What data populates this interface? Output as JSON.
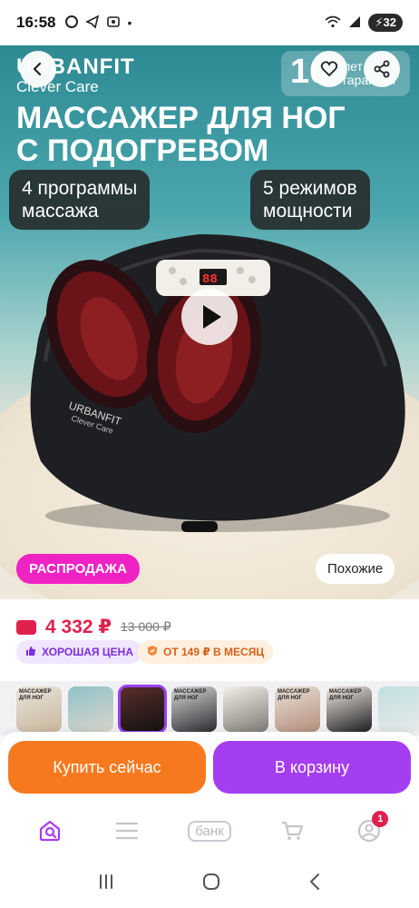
{
  "status_bar": {
    "time": "16:58",
    "battery": "32"
  },
  "hero": {
    "brand_name": "URBANFIT",
    "brand_sub": "Clever Care",
    "warranty_number": "10",
    "warranty_text_1": "лет",
    "warranty_text_2": "гарантии",
    "title_line_1": "МАССАЖЕР ДЛЯ НОГ",
    "title_line_2": "С ПОДОГРЕВОМ",
    "feature_left_1": "4 программы",
    "feature_left_2": "массажа",
    "feature_right_1": "5 режимов",
    "feature_right_2": "мощности",
    "device_brand": "URBANFIT",
    "device_sub": "Clever Care",
    "device_display": "88",
    "sale_label": "РАСПРОДАЖА",
    "similar_label": "Похожие"
  },
  "price": {
    "current": "4 332 ₽",
    "old": "13 000 ₽",
    "chip_good_price": "ХОРОШАЯ ЦЕНА",
    "chip_installment": "ОТ 149 ₽ В МЕСЯЦ"
  },
  "thumbnails": [
    {
      "text": "МАССАЖЕР ДЛЯ НОГ"
    },
    {
      "text": ""
    },
    {
      "text": ""
    },
    {
      "text": "МАССАЖЕР ДЛЯ НОГ"
    },
    {
      "text": ""
    },
    {
      "text": "МАССАЖЕР ДЛЯ НОГ"
    },
    {
      "text": "МАССАЖЕР ДЛЯ НОГ"
    },
    {
      "text": ""
    }
  ],
  "actions": {
    "buy_now": "Купить сейчас",
    "add_to_cart": "В корзину"
  },
  "bottom_nav": {
    "bank_label": "банк",
    "profile_badge": "1"
  },
  "colors": {
    "accent_purple": "#a53df0",
    "buy_orange": "#f7791f",
    "sale_pink": "#ef22c4",
    "price_red": "#e0204d"
  }
}
